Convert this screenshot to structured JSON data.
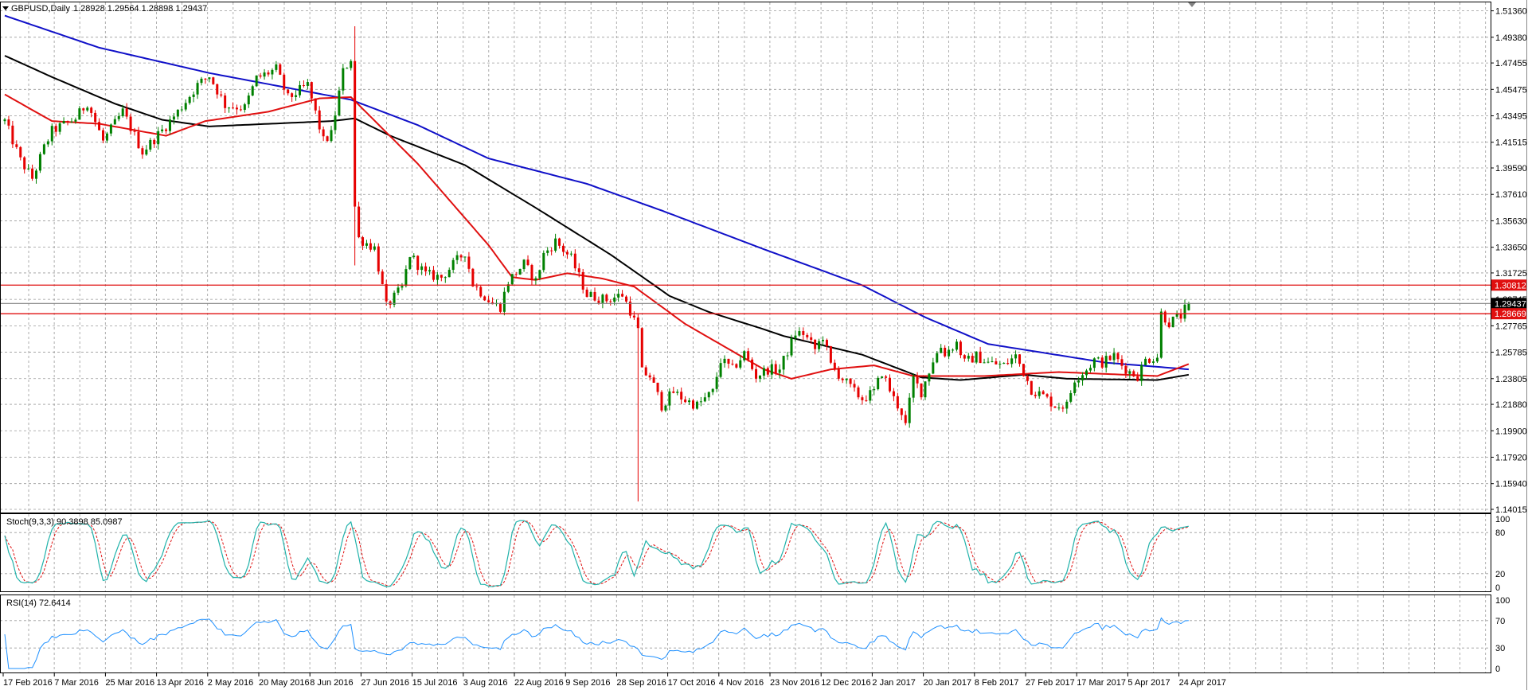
{
  "header": {
    "symbol": "GBPUSD,Daily",
    "ohlc": "1.28928 1.29564 1.28898 1.29437"
  },
  "colors": {
    "bull": "#008000",
    "bear": "#e60000",
    "ma_long": "#1010c8",
    "ma_mid": "#000000",
    "ma_short": "#e01010",
    "level": "#e01010",
    "bid": "#808080",
    "stoch_main": "#20b2aa",
    "stoch_signal": "#e01010",
    "rsi": "#1e90ff",
    "grid": "#9a9a9a"
  },
  "price_axis": {
    "labels": [
      "1.51360",
      "1.49380",
      "1.47455",
      "1.45475",
      "1.43495",
      "1.41515",
      "1.39590",
      "1.37610",
      "1.35630",
      "1.33650",
      "1.31725",
      "1.29745",
      "1.27765",
      "1.25785",
      "1.23805",
      "1.21880",
      "1.19900",
      "1.17920",
      "1.15940",
      "1.14015"
    ]
  },
  "price_tags": [
    {
      "label": "1.30812",
      "value": 1.30812,
      "kind": "level"
    },
    {
      "label": "1.29437",
      "value": 1.29437,
      "kind": "bid"
    },
    {
      "label": "1.28669",
      "value": 1.28669,
      "kind": "level"
    }
  ],
  "date_axis": {
    "labels": [
      "17 Feb 2016",
      "7 Mar 2016",
      "25 Mar 2016",
      "13 Apr 2016",
      "2 May 2016",
      "20 May 2016",
      "8 Jun 2016",
      "27 Jun 2016",
      "15 Jul 2016",
      "3 Aug 2016",
      "22 Aug 2016",
      "9 Sep 2016",
      "28 Sep 2016",
      "17 Oct 2016",
      "4 Nov 2016",
      "23 Nov 2016",
      "12 Dec 2016",
      "2 Jan 2017",
      "20 Jan 2017",
      "8 Feb 2017",
      "27 Feb 2017",
      "17 Mar 2017",
      "5 Apr 2017",
      "24 Apr 2017"
    ]
  },
  "stoch": {
    "label": "Stoch(9,3,3) 90.3898 85.0987",
    "levels": [
      "100",
      "80",
      "20",
      "0"
    ]
  },
  "rsi": {
    "label": "RSI(14) 72.6414",
    "levels": [
      "100",
      "70",
      "30",
      "0"
    ]
  },
  "chart_data": {
    "type": "candlestick",
    "title": "GBPUSD,Daily",
    "bars": 302,
    "ylim": [
      1.14015,
      1.5136
    ],
    "last_bar": {
      "open": 1.28928,
      "high": 1.29564,
      "low": 1.28898,
      "close": 1.29437
    },
    "close_keypoints": [
      [
        0,
        1.431
      ],
      [
        4,
        1.4015
      ],
      [
        7,
        1.388
      ],
      [
        10,
        1.411
      ],
      [
        12,
        1.4236
      ],
      [
        18,
        1.433
      ],
      [
        21,
        1.445
      ],
      [
        25,
        1.416
      ],
      [
        30,
        1.438
      ],
      [
        35,
        1.408
      ],
      [
        40,
        1.424
      ],
      [
        44,
        1.438
      ],
      [
        49,
        1.458
      ],
      [
        52,
        1.465
      ],
      [
        56,
        1.443
      ],
      [
        61,
        1.441
      ],
      [
        64,
        1.463
      ],
      [
        69,
        1.47
      ],
      [
        72,
        1.448
      ],
      [
        77,
        1.458
      ],
      [
        81,
        1.416
      ],
      [
        83,
        1.421
      ],
      [
        86,
        1.468
      ],
      [
        88,
        1.478
      ],
      [
        89,
        1.367
      ],
      [
        90,
        1.343
      ],
      [
        94,
        1.336
      ],
      [
        97,
        1.292
      ],
      [
        101,
        1.306
      ],
      [
        103,
        1.331
      ],
      [
        107,
        1.316
      ],
      [
        111,
        1.314
      ],
      [
        117,
        1.333
      ],
      [
        119,
        1.309
      ],
      [
        124,
        1.294
      ],
      [
        126,
        1.292
      ],
      [
        128,
        1.311
      ],
      [
        132,
        1.324
      ],
      [
        135,
        1.311
      ],
      [
        137,
        1.331
      ],
      [
        140,
        1.341
      ],
      [
        144,
        1.328
      ],
      [
        148,
        1.301
      ],
      [
        153,
        1.297
      ],
      [
        157,
        1.301
      ],
      [
        159,
        1.289
      ],
      [
        161,
        1.274
      ],
      [
        162,
        1.243
      ],
      [
        164,
        1.24
      ],
      [
        167,
        1.218
      ],
      [
        170,
        1.228
      ],
      [
        173,
        1.222
      ],
      [
        176,
        1.218
      ],
      [
        180,
        1.228
      ],
      [
        182,
        1.252
      ],
      [
        185,
        1.245
      ],
      [
        188,
        1.257
      ],
      [
        191,
        1.24
      ],
      [
        194,
        1.245
      ],
      [
        197,
        1.245
      ],
      [
        201,
        1.272
      ],
      [
        203,
        1.272
      ],
      [
        206,
        1.26
      ],
      [
        208,
        1.27
      ],
      [
        210,
        1.248
      ],
      [
        213,
        1.238
      ],
      [
        216,
        1.228
      ],
      [
        218,
        1.223
      ],
      [
        221,
        1.228
      ],
      [
        223,
        1.243
      ],
      [
        226,
        1.223
      ],
      [
        228,
        1.213
      ],
      [
        229,
        1.203
      ],
      [
        231,
        1.238
      ],
      [
        233,
        1.228
      ],
      [
        236,
        1.252
      ],
      [
        238,
        1.262
      ],
      [
        239,
        1.257
      ],
      [
        242,
        1.265
      ],
      [
        244,
        1.25
      ],
      [
        247,
        1.255
      ],
      [
        250,
        1.25
      ],
      [
        254,
        1.248
      ],
      [
        257,
        1.255
      ],
      [
        259,
        1.243
      ],
      [
        261,
        1.23
      ],
      [
        264,
        1.225
      ],
      [
        267,
        1.218
      ],
      [
        270,
        1.218
      ],
      [
        272,
        1.238
      ],
      [
        275,
        1.245
      ],
      [
        277,
        1.252
      ],
      [
        279,
        1.25
      ],
      [
        282,
        1.255
      ],
      [
        284,
        1.248
      ],
      [
        286,
        1.243
      ],
      [
        288,
        1.24
      ],
      [
        290,
        1.252
      ],
      [
        293,
        1.255
      ],
      [
        294,
        1.287
      ],
      [
        296,
        1.28
      ],
      [
        299,
        1.285
      ],
      [
        301,
        1.29437
      ]
    ],
    "wick_overrides": [
      {
        "bar": 89,
        "high": 1.502,
        "low": 1.3229
      },
      {
        "bar": 161,
        "low": 1.146
      }
    ],
    "moving_averages": [
      {
        "name": "MA slow (blue)",
        "color_key": "ma_long",
        "points": [
          [
            0,
            1.51
          ],
          [
            24,
            1.486
          ],
          [
            52,
            1.467
          ],
          [
            88,
            1.447
          ],
          [
            105,
            1.428
          ],
          [
            123,
            1.403
          ],
          [
            148,
            1.384
          ],
          [
            167,
            1.364
          ],
          [
            193,
            1.335
          ],
          [
            218,
            1.308
          ],
          [
            234,
            1.284
          ],
          [
            250,
            1.264
          ],
          [
            280,
            1.25
          ],
          [
            301,
            1.245
          ]
        ]
      },
      {
        "name": "MA mid (black)",
        "color_key": "ma_mid",
        "points": [
          [
            0,
            1.48
          ],
          [
            12,
            1.464
          ],
          [
            28,
            1.444
          ],
          [
            40,
            1.432
          ],
          [
            52,
            1.427
          ],
          [
            83,
            1.431
          ],
          [
            89,
            1.433
          ],
          [
            98,
            1.42
          ],
          [
            117,
            1.398
          ],
          [
            135,
            1.366
          ],
          [
            154,
            1.331
          ],
          [
            169,
            1.3
          ],
          [
            179,
            1.288
          ],
          [
            193,
            1.275
          ],
          [
            198,
            1.27
          ],
          [
            218,
            1.256
          ],
          [
            233,
            1.239
          ],
          [
            243,
            1.237
          ],
          [
            259,
            1.241
          ],
          [
            270,
            1.238
          ],
          [
            293,
            1.237
          ],
          [
            301,
            1.241
          ]
        ]
      },
      {
        "name": "MA fast (red)",
        "color_key": "ma_short",
        "points": [
          [
            0,
            1.451
          ],
          [
            12,
            1.431
          ],
          [
            24,
            1.429
          ],
          [
            41,
            1.42
          ],
          [
            51,
            1.431
          ],
          [
            67,
            1.438
          ],
          [
            80,
            1.448
          ],
          [
            88,
            1.449
          ],
          [
            105,
            1.399
          ],
          [
            123,
            1.338
          ],
          [
            129,
            1.314
          ],
          [
            135,
            1.312
          ],
          [
            143,
            1.317
          ],
          [
            152,
            1.313
          ],
          [
            160,
            1.307
          ],
          [
            173,
            1.279
          ],
          [
            193,
            1.245
          ],
          [
            200,
            1.238
          ],
          [
            210,
            1.245
          ],
          [
            221,
            1.248
          ],
          [
            231,
            1.24
          ],
          [
            249,
            1.24
          ],
          [
            268,
            1.243
          ],
          [
            293,
            1.24
          ],
          [
            301,
            1.249
          ]
        ]
      }
    ],
    "horizontal_levels": [
      1.30812,
      1.28669
    ],
    "bid": 1.29437
  }
}
